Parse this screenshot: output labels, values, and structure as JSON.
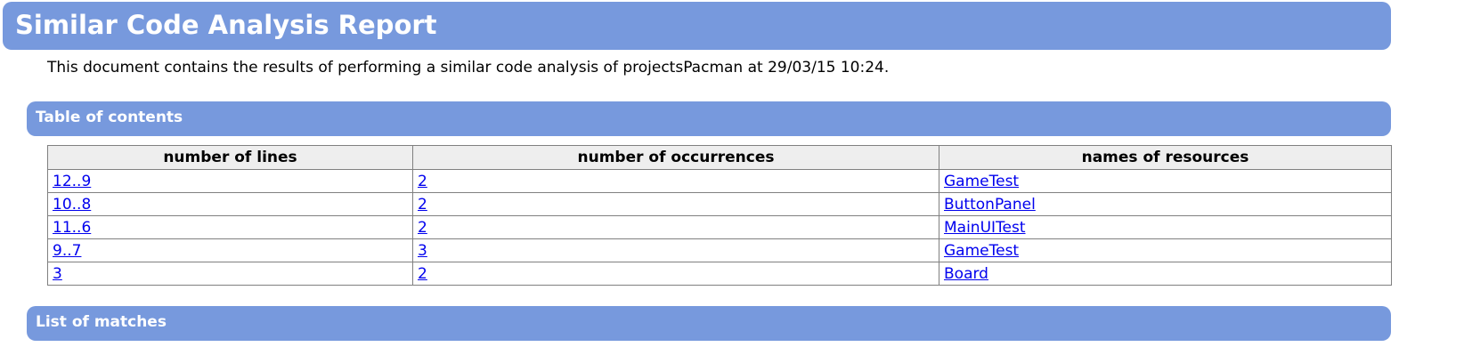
{
  "title": "Similar Code Analysis Report",
  "intro": "This document contains the results of performing a similar code analysis of projectsPacman at 29/03/15 10:24.",
  "sections": {
    "toc": "Table of contents",
    "matches": "List of matches"
  },
  "table": {
    "headers": [
      "number of lines",
      "number of occurrences",
      "names of resources"
    ],
    "rows": [
      [
        "12..9",
        "2",
        "GameTest"
      ],
      [
        "10..8",
        "2",
        "ButtonPanel"
      ],
      [
        "11..6",
        "2",
        "MainUITest"
      ],
      [
        "9..7",
        "3",
        "GameTest"
      ],
      [
        "3",
        "2",
        "Board"
      ]
    ]
  },
  "colors": {
    "bar": "#7799dd",
    "link": "#0000ee",
    "header_bg": "#eeeeee"
  }
}
